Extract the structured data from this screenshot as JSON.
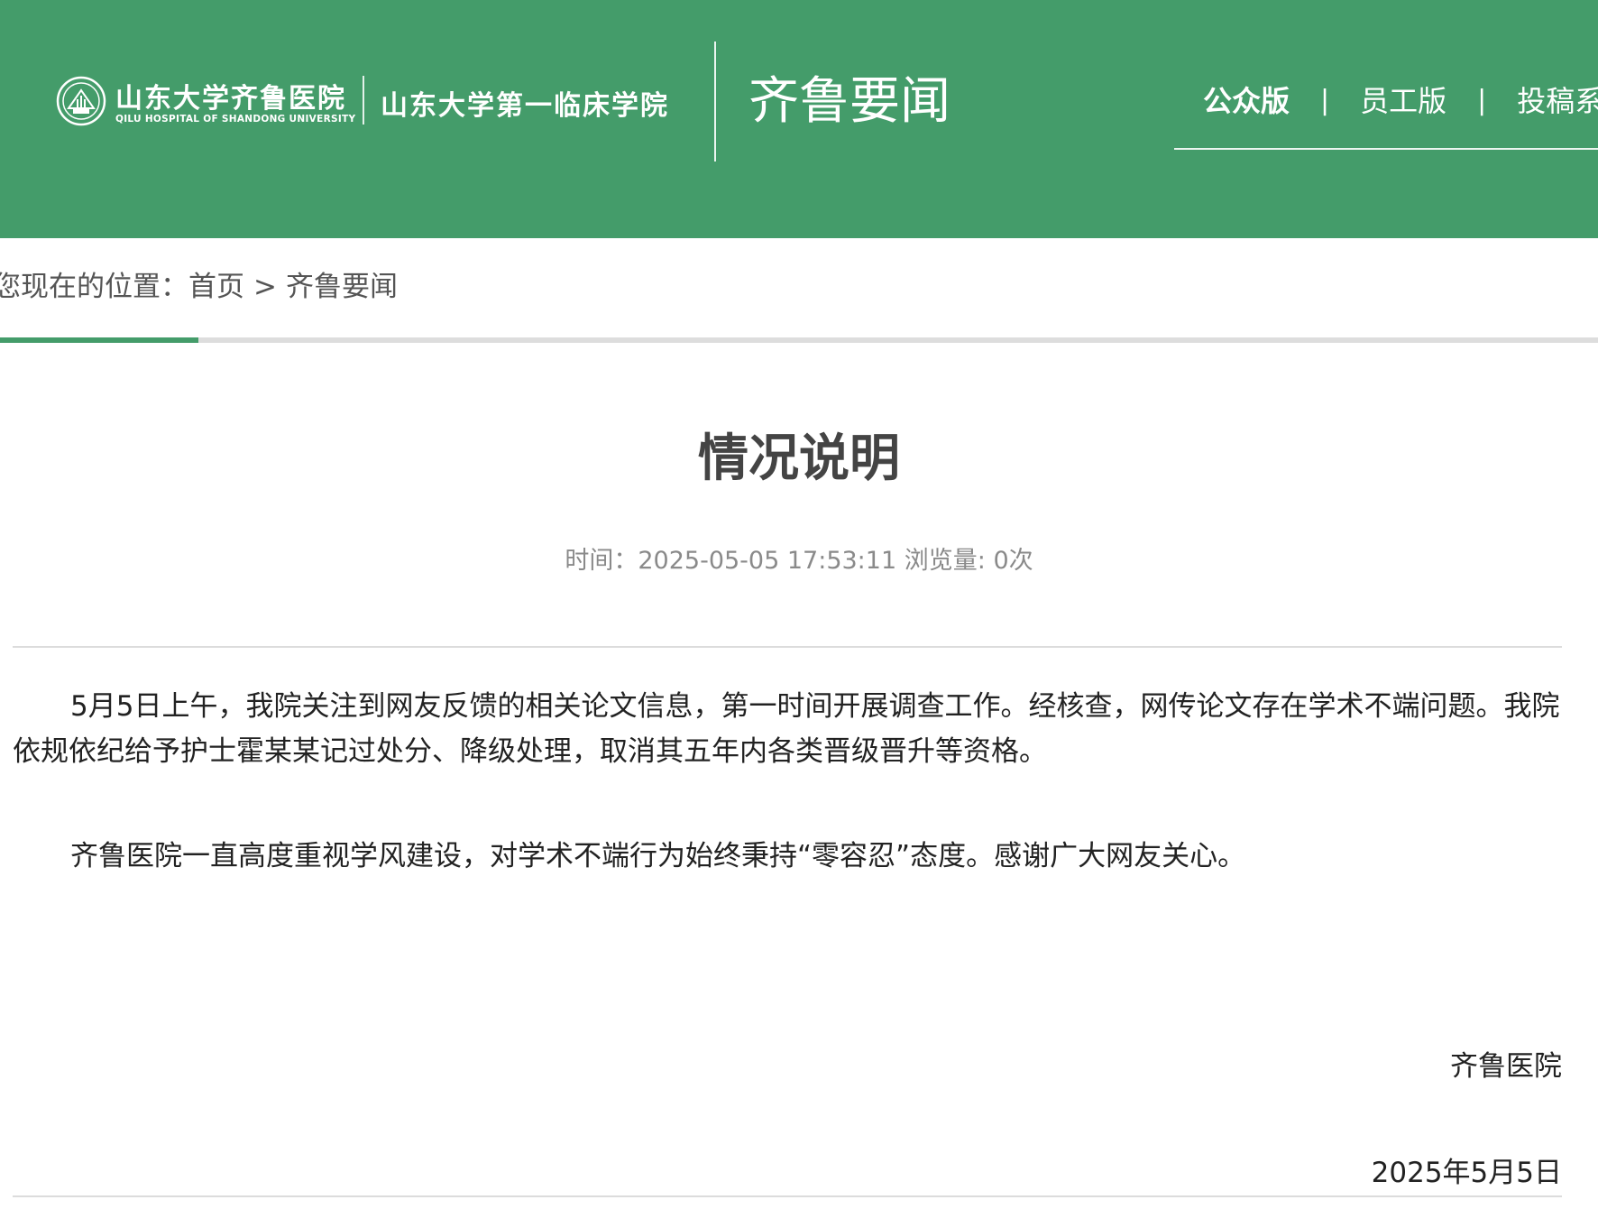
{
  "header": {
    "logo": {
      "name": "山东大学齐鲁医院",
      "english": "QILU HOSPITAL OF SHANDONG UNIVERSITY",
      "college": "山东大学第一临床学院",
      "icon": "hospital-emblem-icon"
    },
    "site_title": "齐鲁要闻",
    "nav": [
      {
        "label": "公众版",
        "active": true
      },
      {
        "label": "员工版",
        "active": false
      },
      {
        "label": "投稿系统",
        "active": false
      }
    ],
    "nav_separator": "|"
  },
  "breadcrumb": {
    "prefix": "您现在的位置：",
    "items": [
      "首页",
      "齐鲁要闻"
    ],
    "separator": ">"
  },
  "article": {
    "title": "情况说明",
    "time_label": "时间：",
    "time": "2025-05-05 17:53:11",
    "views_label": "浏览量:",
    "views": "0次",
    "paragraphs": [
      "5月5日上午，我院关注到网友反馈的相关论文信息，第一时间开展调查工作。经核查，网传论文存在学术不端问题。我院依规依纪给予护士霍某某记过处分、降级处理，取消其五年内各类晋级晋升等资格。",
      "齐鲁医院一直高度重视学风建设，对学术不端行为始终秉持“零容忍”态度。感谢广大网友关心。"
    ],
    "signature": "齐鲁医院",
    "date": "2025年5月5日"
  },
  "colors": {
    "brand_green": "#449c6a",
    "title_gray": "#444444",
    "meta_gray": "#8a8a8a"
  }
}
